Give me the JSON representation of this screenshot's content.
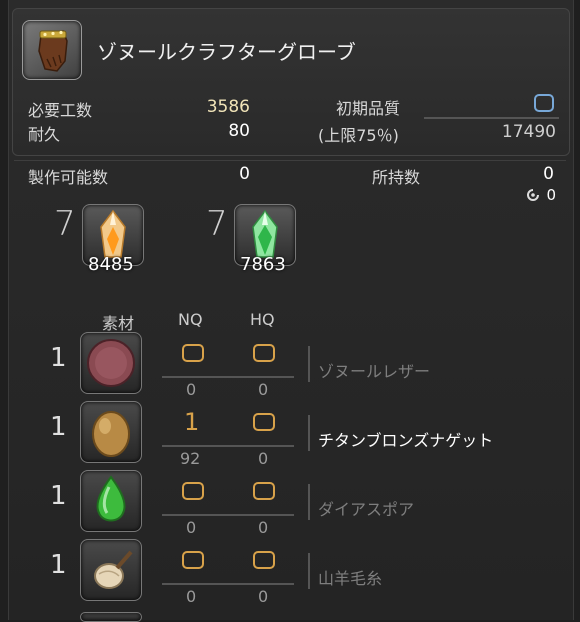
{
  "item": {
    "name": "ゾヌールクラフターグローブ",
    "icon": "glove-icon"
  },
  "stats": {
    "workload_label": "必要工数",
    "workload_value": "3586",
    "durability_label": "耐久",
    "durability_value": "80",
    "quality_label": "初期品質",
    "max_label": "(上限75％)",
    "max_value": "17490"
  },
  "craftable": {
    "label": "製作可能数",
    "value": "0",
    "owned_label": "所持数",
    "owned_value": "0",
    "hq_owned": "0"
  },
  "crystals": [
    {
      "required": "7",
      "owned": "8485",
      "icon": "fire-crystal-icon"
    },
    {
      "required": "7",
      "owned": "7863",
      "icon": "wind-crystal-icon"
    }
  ],
  "columns": {
    "material": "素材",
    "nq": "NQ",
    "hq": "HQ"
  },
  "materials": [
    {
      "count": "1",
      "name": "ゾヌールレザー",
      "nq_owned": "0",
      "hq_owned": "0",
      "nq_selected": "",
      "icon": "leather-icon"
    },
    {
      "count": "1",
      "name": "チタンブロンズナゲット",
      "nq_owned": "92",
      "hq_owned": "0",
      "nq_selected": "1",
      "icon": "nugget-icon"
    },
    {
      "count": "1",
      "name": "ダイアスポア",
      "nq_owned": "0",
      "hq_owned": "0",
      "nq_selected": "",
      "icon": "spore-icon"
    },
    {
      "count": "1",
      "name": "山羊毛糸",
      "nq_owned": "0",
      "hq_owned": "0",
      "nq_selected": "",
      "icon": "yarn-icon"
    }
  ],
  "colors": {
    "accent_slot": "#d8a24a",
    "hq_box": "#78a8d8"
  }
}
